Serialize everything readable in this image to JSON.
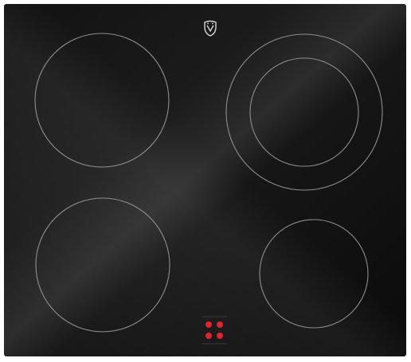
{
  "appliance": {
    "logo": {
      "icon": "vzug-logo-icon"
    },
    "surface_color": "#141414",
    "zone_ring_color": "#8e8e8e",
    "indicator_color": "#e0232e",
    "cooking_zones": [
      {
        "name": "rear-left",
        "rings": 1
      },
      {
        "name": "rear-right",
        "rings": 2
      },
      {
        "name": "front-left",
        "rings": 1
      },
      {
        "name": "front-right",
        "rings": 1
      }
    ],
    "zone_indicator": {
      "icon": "four-dot-indicator-icon",
      "dot_count": 4
    }
  }
}
